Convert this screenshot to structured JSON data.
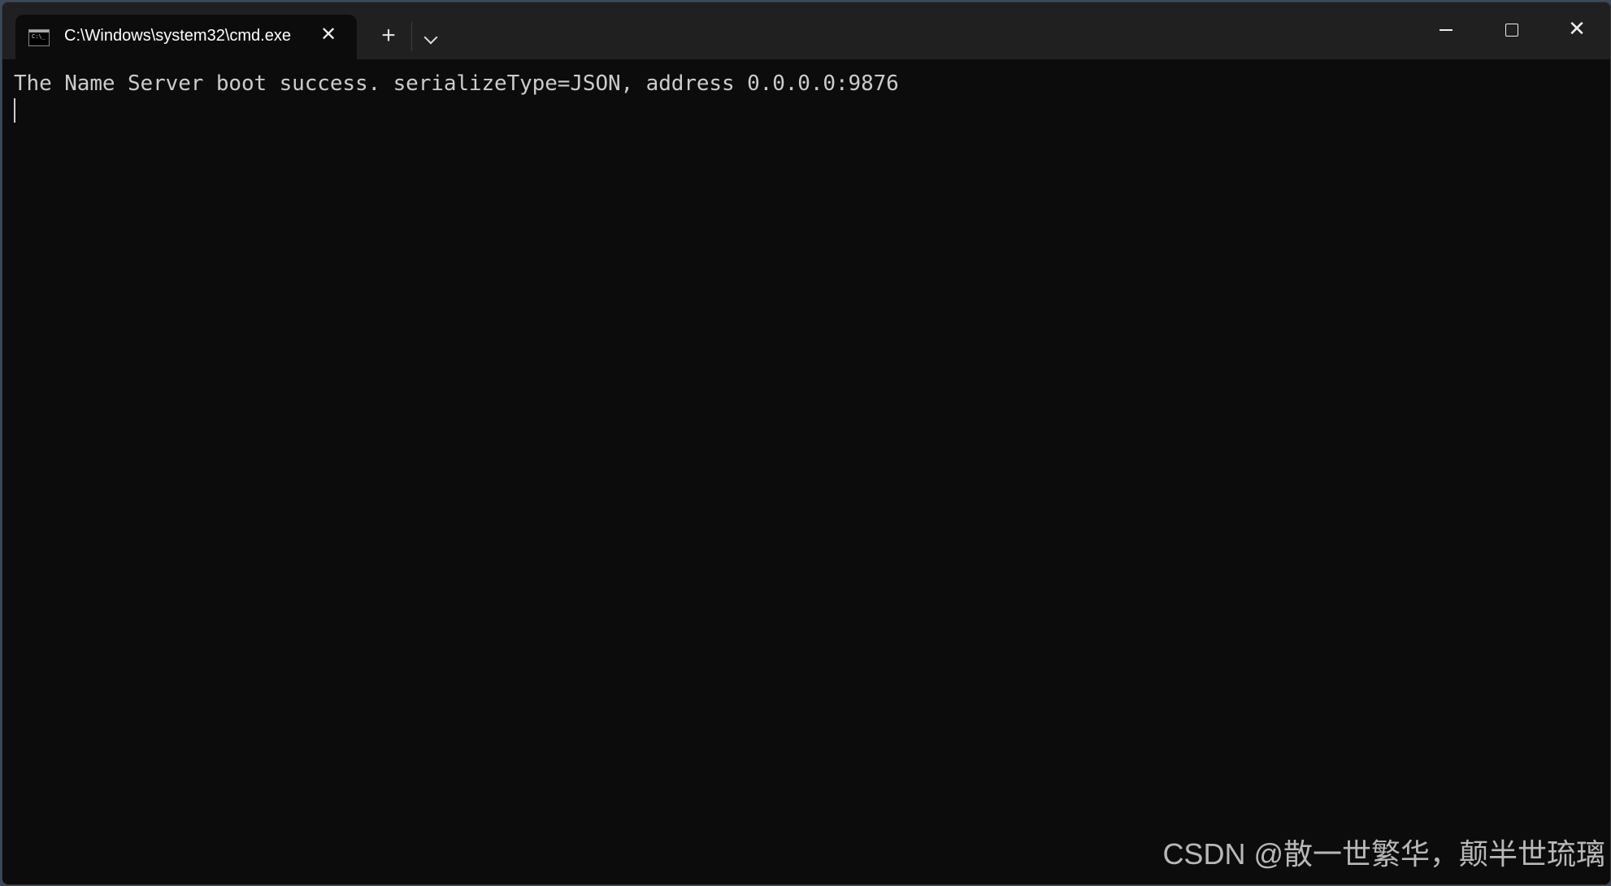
{
  "tab": {
    "title": "C:\\Windows\\system32\\cmd.exe",
    "icon": "cmd-icon",
    "icon_text": "C:\\_"
  },
  "titlebar": {
    "new_tab_label": "+",
    "dropdown_label": "⌄",
    "minimize_label": "—",
    "maximize_label": "☐",
    "close_label": "✕",
    "tab_close_label": "✕"
  },
  "terminal": {
    "lines": [
      "The Name Server boot success. serializeType=JSON, address 0.0.0.0:9876"
    ]
  },
  "watermark": "CSDN @散一世繁华，颠半世琉璃"
}
